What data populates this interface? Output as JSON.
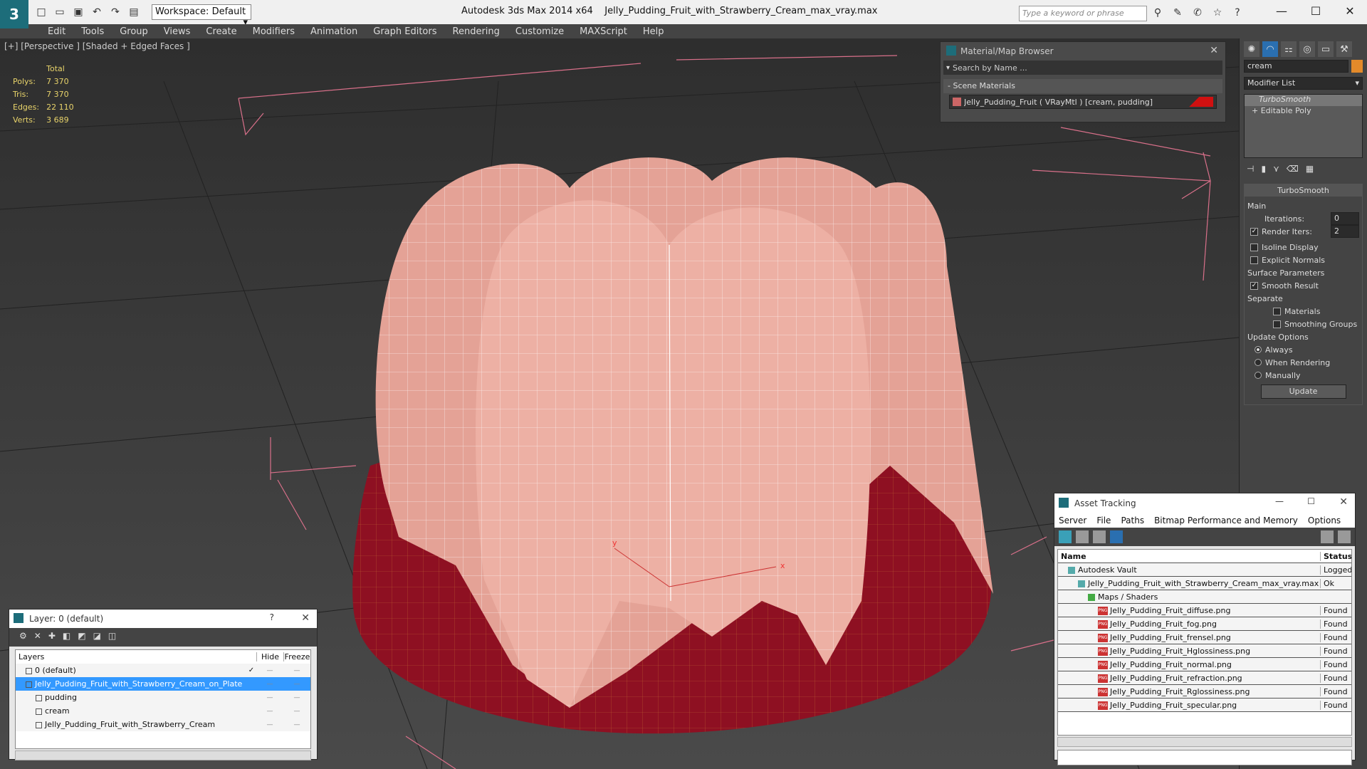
{
  "app": {
    "title": "Autodesk 3ds Max  2014 x64",
    "file": "Jelly_Pudding_Fruit_with_Strawberry_Cream_max_vray.max",
    "workspace": "Workspace: Default",
    "search_placeholder": "Type a keyword or phrase"
  },
  "menu": [
    "Edit",
    "Tools",
    "Group",
    "Views",
    "Create",
    "Modifiers",
    "Animation",
    "Graph Editors",
    "Rendering",
    "Customize",
    "MAXScript",
    "Help"
  ],
  "viewport": {
    "label": "[+] [Perspective ] [Shaded + Edged Faces ]",
    "stats": {
      "header": "Total",
      "rows": [
        {
          "k": "Polys:",
          "v": "7 370"
        },
        {
          "k": "Tris:",
          "v": "7 370"
        },
        {
          "k": "Edges:",
          "v": "22 110"
        },
        {
          "k": "Verts:",
          "v": "3 689"
        }
      ]
    },
    "axis_x": "x",
    "axis_y": "y"
  },
  "material_browser": {
    "title": "Material/Map Browser",
    "search": "Search by Name ...",
    "section": "Scene Materials",
    "item": "Jelly_Pudding_Fruit  ( VRayMtl ) [cream, pudding]"
  },
  "command_panel": {
    "object_name": "cream",
    "modifier_list": "Modifier List",
    "stack": [
      "TurboSmooth",
      "Editable Poly"
    ],
    "turbosmooth": {
      "title": "TurboSmooth",
      "main": "Main",
      "iterations_label": "Iterations:",
      "iterations": "0",
      "render_iters_label": "Render Iters:",
      "render_iters": "2",
      "isoline": "Isoline Display",
      "explicit": "Explicit Normals",
      "surface": "Surface Parameters",
      "smooth": "Smooth Result",
      "separate": "Separate",
      "materials": "Materials",
      "smoothing": "Smoothing Groups",
      "update_options": "Update Options",
      "always": "Always",
      "when_rendering": "When Rendering",
      "manually": "Manually",
      "update": "Update"
    }
  },
  "asset_tracking": {
    "title": "Asset Tracking",
    "menu": [
      "Server",
      "File",
      "Paths",
      "Bitmap Performance and Memory",
      "Options"
    ],
    "col_name": "Name",
    "col_status": "Status",
    "rows": [
      {
        "name": "Autodesk Vault",
        "status": "Logged",
        "indent": 1,
        "icon": "vault"
      },
      {
        "name": "Jelly_Pudding_Fruit_with_Strawberry_Cream_max_vray.max",
        "status": "Ok",
        "indent": 2,
        "icon": "max"
      },
      {
        "name": "Maps / Shaders",
        "status": "",
        "indent": 3,
        "icon": "folder"
      },
      {
        "name": "Jelly_Pudding_Fruit_diffuse.png",
        "status": "Found",
        "indent": 4,
        "icon": "png"
      },
      {
        "name": "Jelly_Pudding_Fruit_fog.png",
        "status": "Found",
        "indent": 4,
        "icon": "png"
      },
      {
        "name": "Jelly_Pudding_Fruit_frensel.png",
        "status": "Found",
        "indent": 4,
        "icon": "png"
      },
      {
        "name": "Jelly_Pudding_Fruit_Hglossiness.png",
        "status": "Found",
        "indent": 4,
        "icon": "png"
      },
      {
        "name": "Jelly_Pudding_Fruit_normal.png",
        "status": "Found",
        "indent": 4,
        "icon": "png"
      },
      {
        "name": "Jelly_Pudding_Fruit_refraction.png",
        "status": "Found",
        "indent": 4,
        "icon": "png"
      },
      {
        "name": "Jelly_Pudding_Fruit_Rglossiness.png",
        "status": "Found",
        "indent": 4,
        "icon": "png"
      },
      {
        "name": "Jelly_Pudding_Fruit_specular.png",
        "status": "Found",
        "indent": 4,
        "icon": "png"
      }
    ]
  },
  "layers": {
    "title": "Layer: 0 (default)",
    "help": "?",
    "col_layers": "Layers",
    "col_hide": "Hide",
    "col_freeze": "Freeze",
    "rows": [
      {
        "name": "0 (default)",
        "indent": 1,
        "selected": false,
        "check": true
      },
      {
        "name": "Jelly_Pudding_Fruit_with_Strawberry_Cream_on_Plate",
        "indent": 1,
        "selected": true,
        "check": false
      },
      {
        "name": "pudding",
        "indent": 2,
        "selected": false,
        "check": false
      },
      {
        "name": "cream",
        "indent": 2,
        "selected": false,
        "check": false
      },
      {
        "name": "Jelly_Pudding_Fruit_with_Strawberry_Cream",
        "indent": 2,
        "selected": false,
        "check": false
      }
    ]
  },
  "colors": {
    "accent": "#3399ff",
    "jelly": "#8e1022",
    "cream": "#e7a49a",
    "material_swatch": "#d01010"
  }
}
